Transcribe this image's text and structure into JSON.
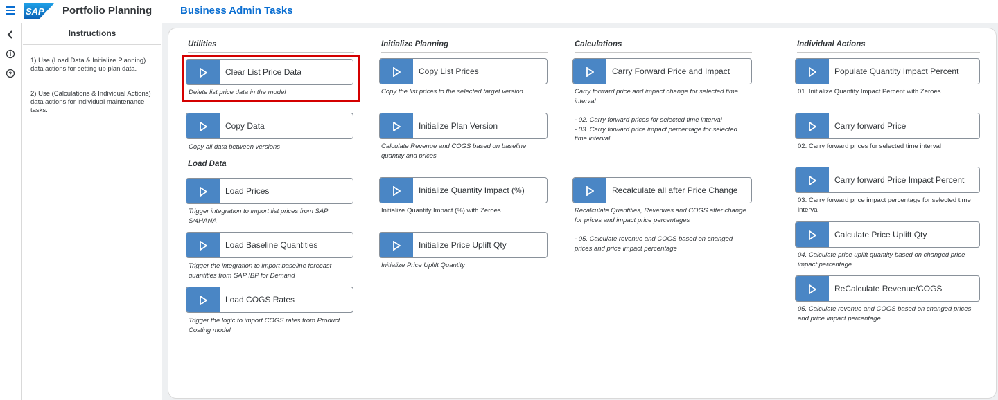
{
  "header": {
    "logo_text": "SAP",
    "app_title": "Portfolio Planning",
    "page_title": "Business Admin Tasks"
  },
  "instructions": {
    "title": "Instructions",
    "items": [
      "1) Use (Load Data & Initialize Planning) data actions for setting up plan data.",
      "2) Use (Calculations & Individual Actions) data actions for individual maintenance tasks."
    ]
  },
  "sections": {
    "utilities": "Utilities",
    "load_data": "Load Data",
    "initialize_planning": "Initialize Planning",
    "calculations": "Calculations",
    "individual_actions": "Individual Actions"
  },
  "utilities": [
    {
      "label": "Clear List Price Data",
      "desc": "Delete list price data in the model"
    },
    {
      "label": "Copy Data",
      "desc": "Copy all data between versions"
    }
  ],
  "load_data": [
    {
      "label": "Load Prices",
      "desc": "Trigger integration to import list prices from SAP S/4HANA"
    },
    {
      "label": "Load Baseline Quantities",
      "desc": "Trigger the integration to import baseline forecast quantities from SAP IBP for Demand"
    },
    {
      "label": "Load COGS Rates",
      "desc": "Trigger the logic to import COGS rates from Product Costing model"
    }
  ],
  "initialize_planning": [
    {
      "label": "Copy List Prices",
      "desc": "Copy the list prices to the selected target version"
    },
    {
      "label": "Initialize Plan Version",
      "desc": "Calculate Revenue and COGS based on baseline quantity and prices"
    },
    {
      "label": "Initialize Quantity Impact (%)",
      "desc": "Initialize Quantity Impact (%) with Zeroes"
    },
    {
      "label": "Initialize Price Uplift Qty",
      "desc": "Initialize Price Uplift Quantity"
    }
  ],
  "calculations": [
    {
      "label": "Carry Forward Price and Impact",
      "desc": "Carry forward price and impact change for selected time interval",
      "note": "- 02. Carry forward prices for selected time interval\n- 03. Carry forward price impact percentage for selected time interval"
    },
    {
      "label": "Recalculate all after Price Change",
      "desc": "Recalculate Quantities, Revenues and COGS after change for prices and impact price percentages",
      "note": "- 05. Calculate revenue and COGS based on changed prices and price impact percentage"
    }
  ],
  "individual_actions": [
    {
      "label": "Populate Quantity Impact Percent",
      "desc": "01. Initialize Quantity Impact Percent with Zeroes"
    },
    {
      "label": "Carry forward Price",
      "desc": "02. Carry forward prices for selected time interval"
    },
    {
      "label": "Carry forward Price Impact Percent",
      "desc": "03. Carry forward price impact percentage for selected time interval"
    },
    {
      "label": "Calculate Price Uplift Qty",
      "desc": "04. Calculate price uplift quantity based on changed price impact percentage"
    },
    {
      "label": "ReCalculate Revenue/COGS",
      "desc": "05. Calculate revenue and COGS based on changed prices and price impact percentage"
    }
  ],
  "icons": {
    "menu": "hamburger-icon",
    "back": "chevron-left-icon",
    "info": "info-icon",
    "help": "help-icon",
    "run": "play-icon"
  },
  "colors": {
    "brand_blue": "#0a6ed1",
    "play_button": "#4a86c5",
    "highlight": "#d40000"
  }
}
